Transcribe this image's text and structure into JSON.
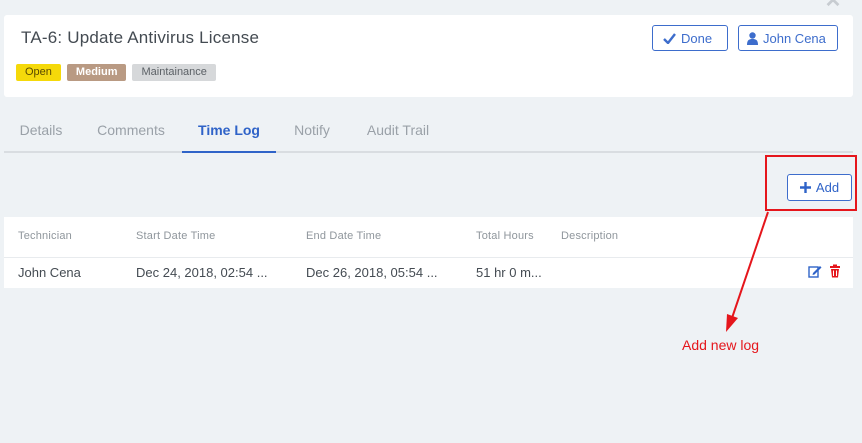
{
  "ticket": {
    "title": "TA-6: Update Antivirus License",
    "badges": {
      "status": "Open",
      "priority": "Medium",
      "category": "Maintainance"
    },
    "done_label": "Done",
    "assignee_label": "John Cena"
  },
  "tabs": [
    {
      "label": "Details"
    },
    {
      "label": "Comments"
    },
    {
      "label": "Time Log",
      "active": true
    },
    {
      "label": "Notify"
    },
    {
      "label": "Audit Trail"
    }
  ],
  "toolbar": {
    "add_label": "Add"
  },
  "table": {
    "headers": [
      "Technician",
      "Start Date Time",
      "End Date Time",
      "Total Hours",
      "Description"
    ],
    "rows": [
      {
        "technician": "John Cena",
        "start": "Dec 24, 2018, 02:54 ...",
        "end": "Dec 26, 2018, 05:54 ...",
        "total_hours": "51 hr 0 m...",
        "description": ""
      }
    ]
  },
  "annotation": {
    "text": "Add new log",
    "color": "#e5161c"
  },
  "icons": {
    "close": "close-icon",
    "done": "check-icon",
    "assignee": "user-icon",
    "add": "plus-icon",
    "edit": "edit-icon",
    "delete": "trash-icon"
  },
  "colors": {
    "accent": "#2f63c8",
    "status_open": "#f5d90a",
    "priority_medium": "#b99a83",
    "category": "#d6d8da",
    "annotation": "#e5161c"
  }
}
